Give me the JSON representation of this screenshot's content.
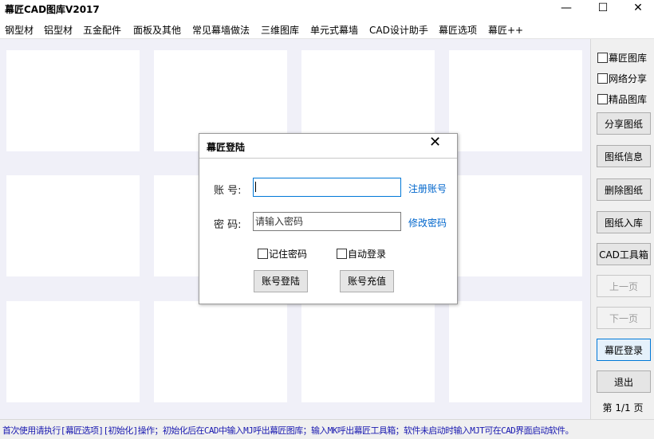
{
  "window": {
    "title": "幕匠CAD图库V2017",
    "minimize_glyph": "—",
    "maximize_glyph": "☐",
    "close_glyph": "✕"
  },
  "menu": {
    "items": [
      "钢型材",
      "铝型材",
      "五金配件",
      "面板及其他",
      "常见幕墙做法",
      "三维图库",
      "单元式幕墙",
      "CAD设计助手",
      "幕匠选项",
      "幕匠++"
    ]
  },
  "sidebar": {
    "checkboxes": [
      {
        "label": "幕匠图库",
        "checked": false
      },
      {
        "label": "网络分享",
        "checked": false
      },
      {
        "label": "精品图库",
        "checked": false
      }
    ],
    "buttons": [
      "分享图纸",
      "图纸信息",
      "删除图纸",
      "图纸入库",
      "CAD工具箱",
      "上一页",
      "下一页",
      "幕匠登录",
      "退出"
    ],
    "page_info": "第 1/1 页"
  },
  "status": {
    "text": "首次使用请执行[幕匠选项][初始化]操作；初始化后在CAD中输入MJ呼出幕匠图库；输入MK呼出幕匠工具箱；软件未启动时输入MJT可在CAD界面启动软件。",
    "color": "#1a1ab0"
  },
  "login_dialog": {
    "title": "幕匠登陆",
    "close_glyph": "✕",
    "account_label": "账 号:",
    "account_value": "",
    "password_label": "密 码:",
    "password_placeholder": "请输入密码",
    "register_link": "注册账号",
    "change_password_link": "修改密码",
    "remember_label": "记住密码",
    "auto_login_label": "自动登录",
    "login_button": "账号登陆",
    "recharge_button": "账号充值"
  },
  "colors": {
    "grid_background": "#f0f0f8",
    "link": "#0066cc",
    "focus_border": "#0078d7"
  }
}
